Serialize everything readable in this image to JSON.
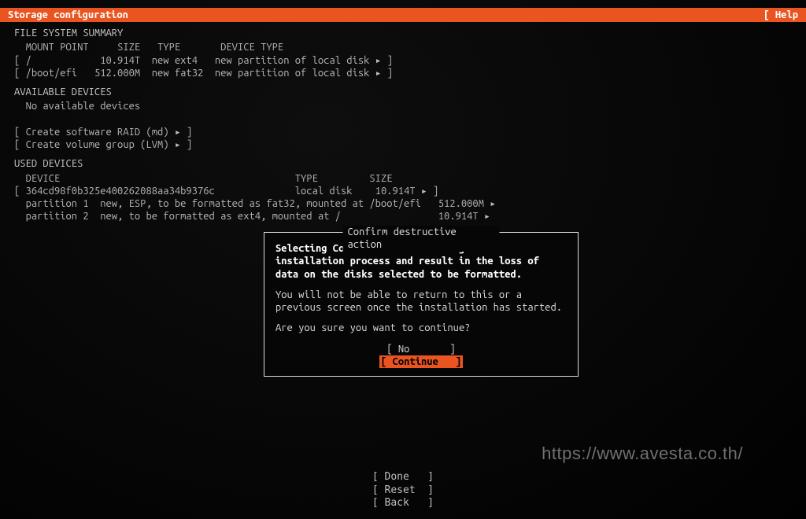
{
  "titlebar": {
    "title": "Storage configuration",
    "help": "[ Help"
  },
  "fs_summary": {
    "heading": "FILE SYSTEM SUMMARY",
    "cols": {
      "mount": "MOUNT POINT",
      "size": "SIZE",
      "type": "TYPE",
      "devtype": "DEVICE TYPE"
    },
    "rows": [
      {
        "mount": "/",
        "size": "10.914T",
        "type": "new ext4",
        "devtype": "new partition of local disk"
      },
      {
        "mount": "/boot/efi",
        "size": "512.000M",
        "type": "new fat32",
        "devtype": "new partition of local disk"
      }
    ]
  },
  "available": {
    "heading": "AVAILABLE DEVICES",
    "none": "No available devices",
    "raid": "Create software RAID (md)",
    "lvm": "Create volume group (LVM)"
  },
  "used": {
    "heading": "USED DEVICES",
    "cols": {
      "device": "DEVICE",
      "type": "TYPE",
      "size": "SIZE"
    },
    "disk": {
      "id": "364cd98f0b325e400262088aa34b9376c",
      "type": "local disk",
      "size": "10.914T"
    },
    "parts": [
      {
        "line": "partition 1  new, ESP, to be formatted as fat32, mounted at /boot/efi",
        "size": "512.000M"
      },
      {
        "line": "partition 2  new, to be formatted as ext4, mounted at /",
        "size": "10.914T"
      }
    ]
  },
  "dialog": {
    "title": "Confirm destructive action",
    "p1": "Selecting Continue below will begin the installation process and result in the loss of data on the disks selected to be formatted.",
    "p2": "You will not be able to return to this or a previous screen once the installation has started.",
    "p3": "Are you sure you want to continue?",
    "no": "No",
    "continue": "Continue"
  },
  "footer": {
    "done": "Done",
    "reset": "Reset",
    "back": "Back"
  },
  "watermark": "https://www.avesta.co.th/"
}
